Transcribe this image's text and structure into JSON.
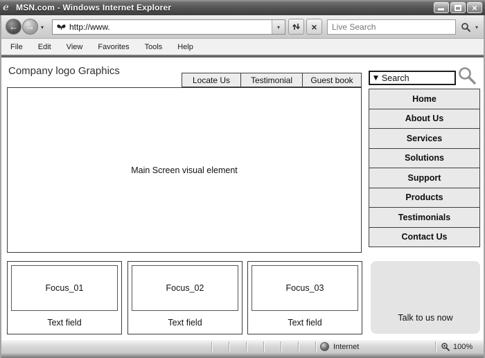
{
  "window": {
    "title": "MSN.com - Windows Internet Explorer"
  },
  "chrome": {
    "url": "http://www.",
    "live_search_placeholder": "Live Search",
    "menu_items": [
      "File",
      "Edit",
      "View",
      "Favorites",
      "Tools",
      "Help"
    ],
    "status": {
      "zone": "Internet",
      "zoom": "100%"
    }
  },
  "icons": {
    "back_arrow": "←",
    "forward_arrow": "→",
    "close": "×",
    "stop": "×",
    "caret_down": "▾",
    "triangle_down": "▼"
  },
  "page": {
    "logo_text": "Company logo Graphics",
    "tabs": [
      "Locate Us",
      "Testimonial",
      "Guest book"
    ],
    "search_label": "Search",
    "main_label": "Main Screen visual element",
    "nav_items": [
      "Home",
      "About Us",
      "Services",
      "Solutions",
      "Support",
      "Products",
      "Testimonials",
      "Contact Us"
    ],
    "focus_cards": [
      {
        "title": "Focus_01",
        "caption": "Text field"
      },
      {
        "title": "Focus_02",
        "caption": "Text field"
      },
      {
        "title": "Focus_03",
        "caption": "Text field"
      }
    ],
    "talk_label": "Talk to us now"
  },
  "colors": {
    "titlebar_dark": "#3d3d3d",
    "chrome_gray": "#d6d6d6",
    "wireframe_fill": "#e9e9e9",
    "border_dark": "#3a3a3a",
    "talkbox_fill": "#e4e4e4"
  }
}
